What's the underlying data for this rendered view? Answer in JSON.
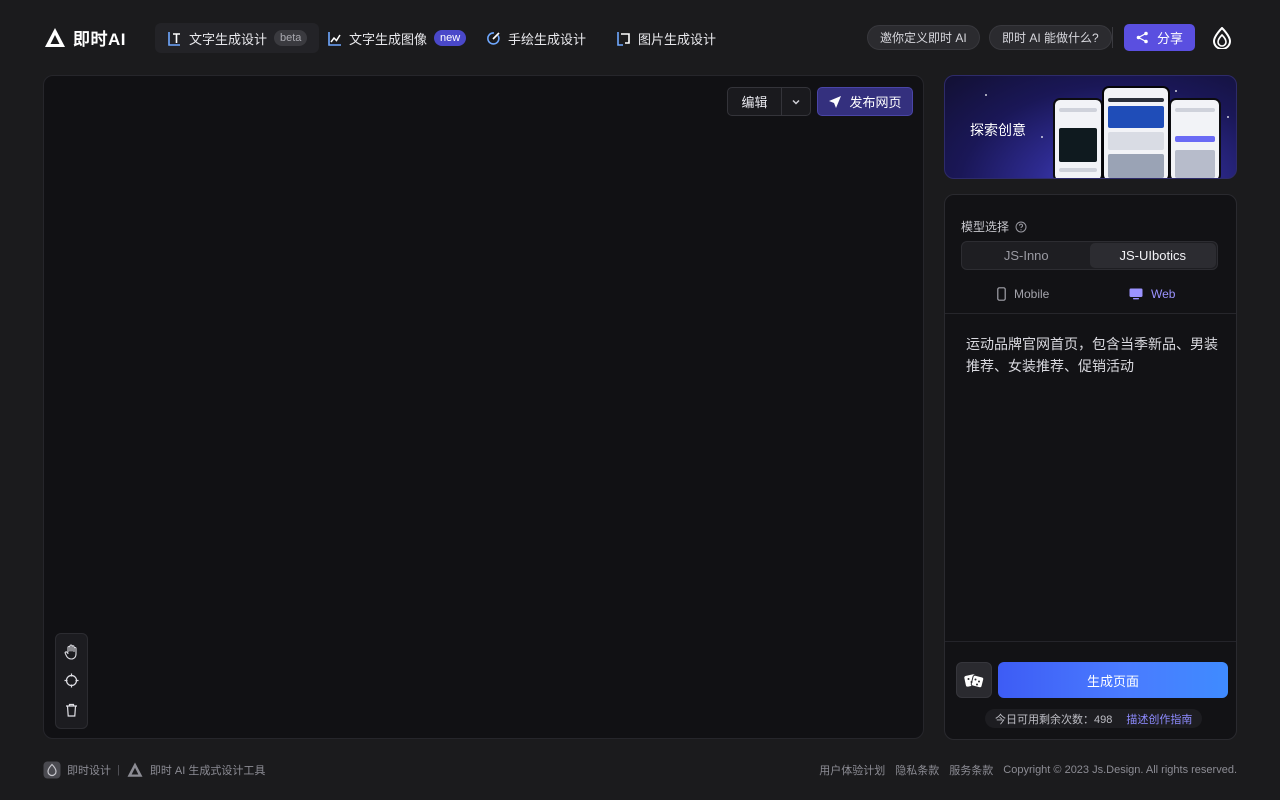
{
  "brand": {
    "name": "即时AI"
  },
  "nav": {
    "tabs": [
      {
        "label": "文字生成设计",
        "badge": "beta",
        "icon": "text-gen-icon",
        "active": true
      },
      {
        "label": "文字生成图像",
        "badge": "new",
        "icon": "image-gen-icon",
        "active": false
      },
      {
        "label": "手绘生成设计",
        "badge": "",
        "icon": "sketch-icon",
        "active": false
      },
      {
        "label": "图片生成设计",
        "badge": "",
        "icon": "picture-icon",
        "active": false
      }
    ],
    "invite": "邀你定义即时 AI",
    "what_can": "即时 AI 能做什么?",
    "share": "分享"
  },
  "canvas": {
    "edit_label": "编辑",
    "publish_label": "发布网页",
    "tools": [
      "hand-icon",
      "target-icon",
      "trash-icon"
    ]
  },
  "banner": {
    "title": "探索创意"
  },
  "panel": {
    "model_label": "模型选择",
    "models": [
      "JS-Inno",
      "JS-UIbotics"
    ],
    "selected_model": "JS-UIbotics",
    "devices": [
      "Mobile",
      "Web"
    ],
    "selected_device": "Web",
    "prompt": "运动品牌官网首页，包含当季新品、男装推荐、女装推荐、促销活动",
    "generate_label": "生成页面",
    "quota_text": "今日可用剩余次数：498",
    "guide_link": "描述创作指南"
  },
  "footer": {
    "brand1": "即时设计",
    "brand2": "即时 AI 生成式设计工具",
    "links": [
      "用户体验计划",
      "隐私条款",
      "服务条款"
    ],
    "copyright": "Copyright © 2023 Js.Design. All rights reserved."
  },
  "colors": {
    "accent": "#5a4fe0",
    "primary_gradient_start": "#3d5cf5",
    "primary_gradient_end": "#3f8bff",
    "background": "#1b1b1d"
  }
}
